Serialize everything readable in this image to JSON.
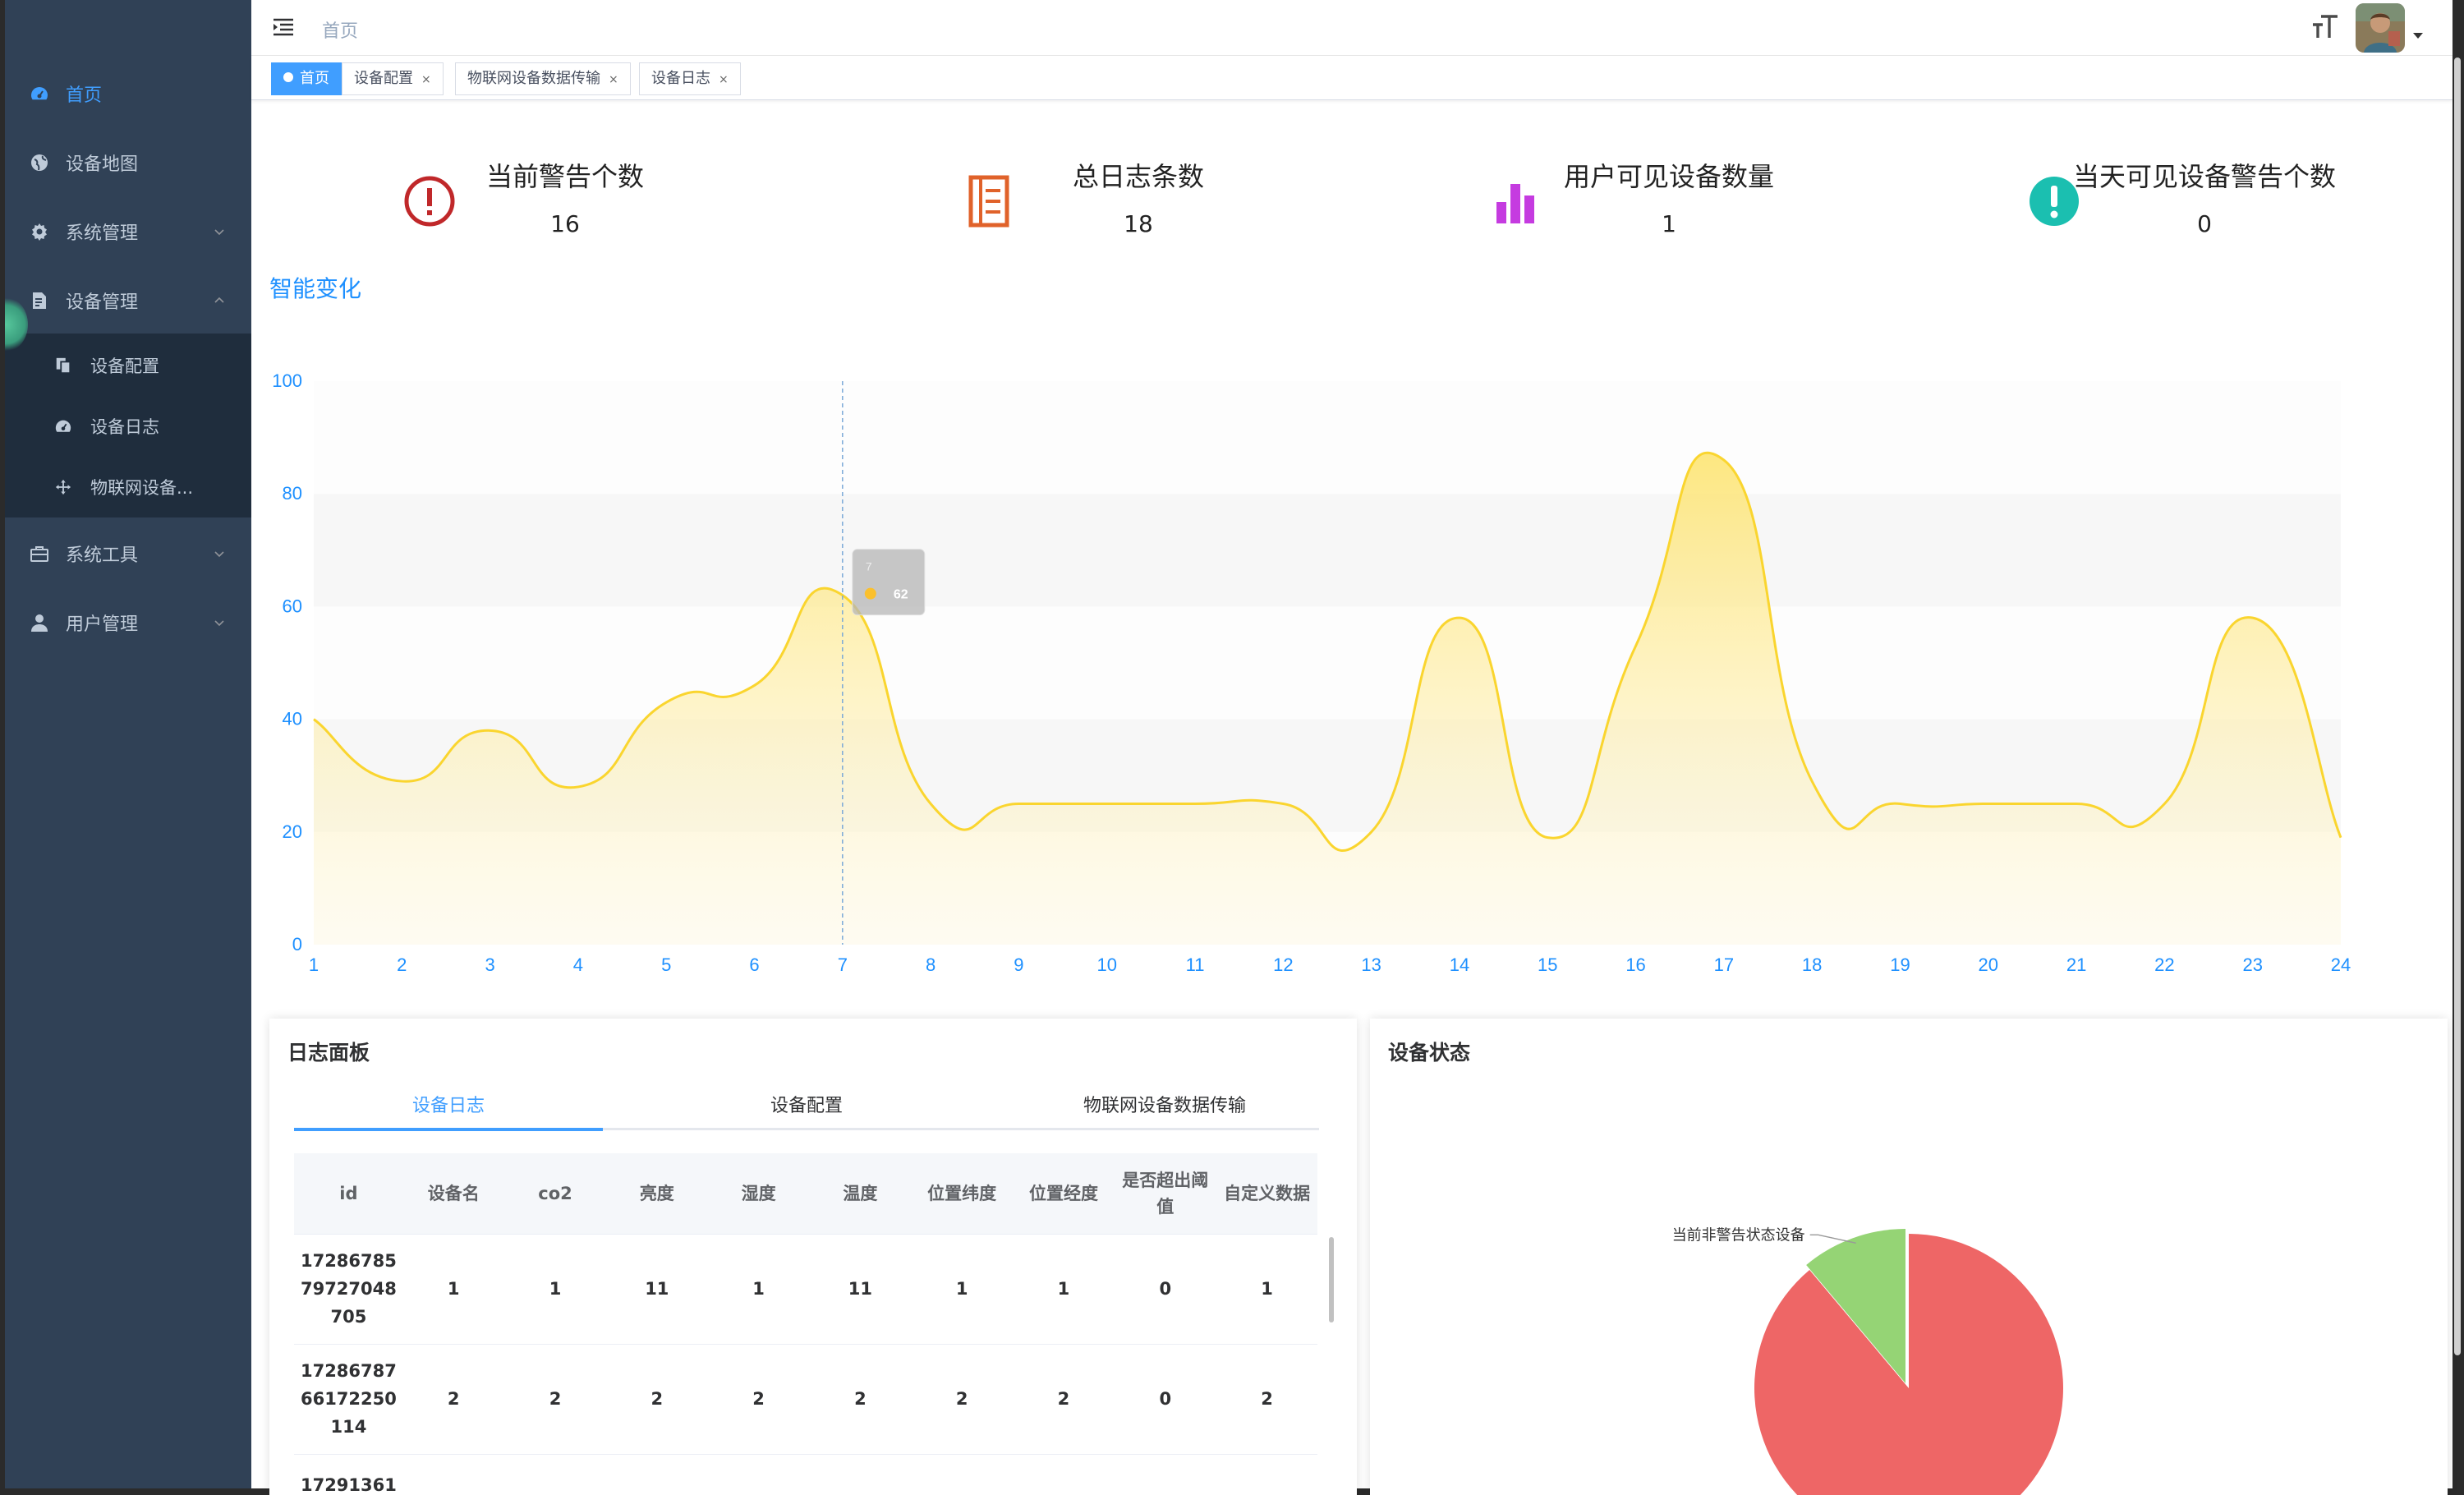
{
  "sidebar": {
    "items": [
      {
        "label": "首页",
        "icon": "dashboard-icon",
        "active": true
      },
      {
        "label": "设备地图",
        "icon": "globe-icon"
      },
      {
        "label": "系统管理",
        "icon": "gear-icon"
      },
      {
        "label": "设备管理",
        "icon": "document-icon",
        "expanded": true
      },
      {
        "label": "系统工具",
        "icon": "toolbox-icon"
      },
      {
        "label": "用户管理",
        "icon": "user-icon"
      }
    ],
    "subitems": [
      {
        "label": "设备配置",
        "icon": "copy-icon"
      },
      {
        "label": "设备日志",
        "icon": "dashboard-icon"
      },
      {
        "label": "物联网设备...",
        "icon": "move-icon"
      }
    ]
  },
  "navbar": {
    "breadcrumb": "首页"
  },
  "tags": [
    {
      "label": "首页",
      "active": true
    },
    {
      "label": "设备配置",
      "close": "×"
    },
    {
      "label": "物联网设备数据传输",
      "close": "×"
    },
    {
      "label": "设备日志",
      "close": "×"
    }
  ],
  "stats": [
    {
      "title": "当前警告个数",
      "value": "16",
      "icon": "alert-circle-icon",
      "color": "#c0282a"
    },
    {
      "title": "总日志条数",
      "value": "18",
      "icon": "notebook-icon",
      "color": "#e0622a"
    },
    {
      "title": "用户可见设备数量",
      "value": "1",
      "icon": "bar-chart-icon",
      "color": "#c53be0"
    },
    {
      "title": "当天可见设备警告个数",
      "value": "0",
      "icon": "exclamation-circle-icon",
      "color": "#1bbfb0"
    }
  ],
  "chart_title": "智能变化",
  "chart_data": {
    "type": "area",
    "x": [
      1,
      2,
      3,
      4,
      5,
      6,
      7,
      8,
      9,
      10,
      11,
      12,
      13,
      14,
      15,
      16,
      17,
      18,
      19,
      20,
      21,
      22,
      23,
      24
    ],
    "series": [
      {
        "values": [
          40,
          29,
          38,
          28,
          43,
          46,
          62,
          25,
          25,
          25,
          25,
          25,
          20,
          58,
          19,
          53,
          86,
          29,
          25,
          25,
          25,
          25,
          58,
          19
        ]
      }
    ],
    "ylim": [
      0,
      100
    ],
    "yticks": [
      "0",
      "20",
      "40",
      "60",
      "80",
      "100"
    ],
    "xticks": [
      "1",
      "2",
      "3",
      "4",
      "5",
      "6",
      "7",
      "8",
      "9",
      "10",
      "11",
      "12",
      "13",
      "14",
      "15",
      "16",
      "17",
      "18",
      "19",
      "20",
      "21",
      "22",
      "23",
      "24"
    ],
    "line_color": "#fad52f",
    "axis_label_color": "#1e90ff",
    "tooltip": {
      "x_label": "7",
      "value": "62"
    },
    "grid": true
  },
  "log_panel": {
    "title": "日志面板",
    "tabs": [
      "设备日志",
      "设备配置",
      "物联网设备数据传输"
    ],
    "columns": [
      "id",
      "设备名",
      "co2",
      "亮度",
      "湿度",
      "温度",
      "位置纬度",
      "位置经度",
      "是否超出阈值",
      "自定义数据"
    ],
    "rows": [
      [
        "1728678579727048705",
        "1",
        "1",
        "11",
        "1",
        "11",
        "1",
        "1",
        "0",
        "1"
      ],
      [
        "1728678766172250114",
        "2",
        "2",
        "2",
        "2",
        "2",
        "2",
        "2",
        "0",
        "2"
      ],
      [
        "17291361",
        "",
        "",
        "",
        "",
        "",
        "",
        "",
        "",
        ""
      ]
    ]
  },
  "status_panel": {
    "title": "设备状态",
    "chart_data": {
      "type": "pie",
      "slices": [
        {
          "label": "当前非警告状态设备",
          "value": 2,
          "color": "#95d475"
        },
        {
          "label": "",
          "value": 16,
          "color": "#ee6666"
        }
      ]
    }
  }
}
